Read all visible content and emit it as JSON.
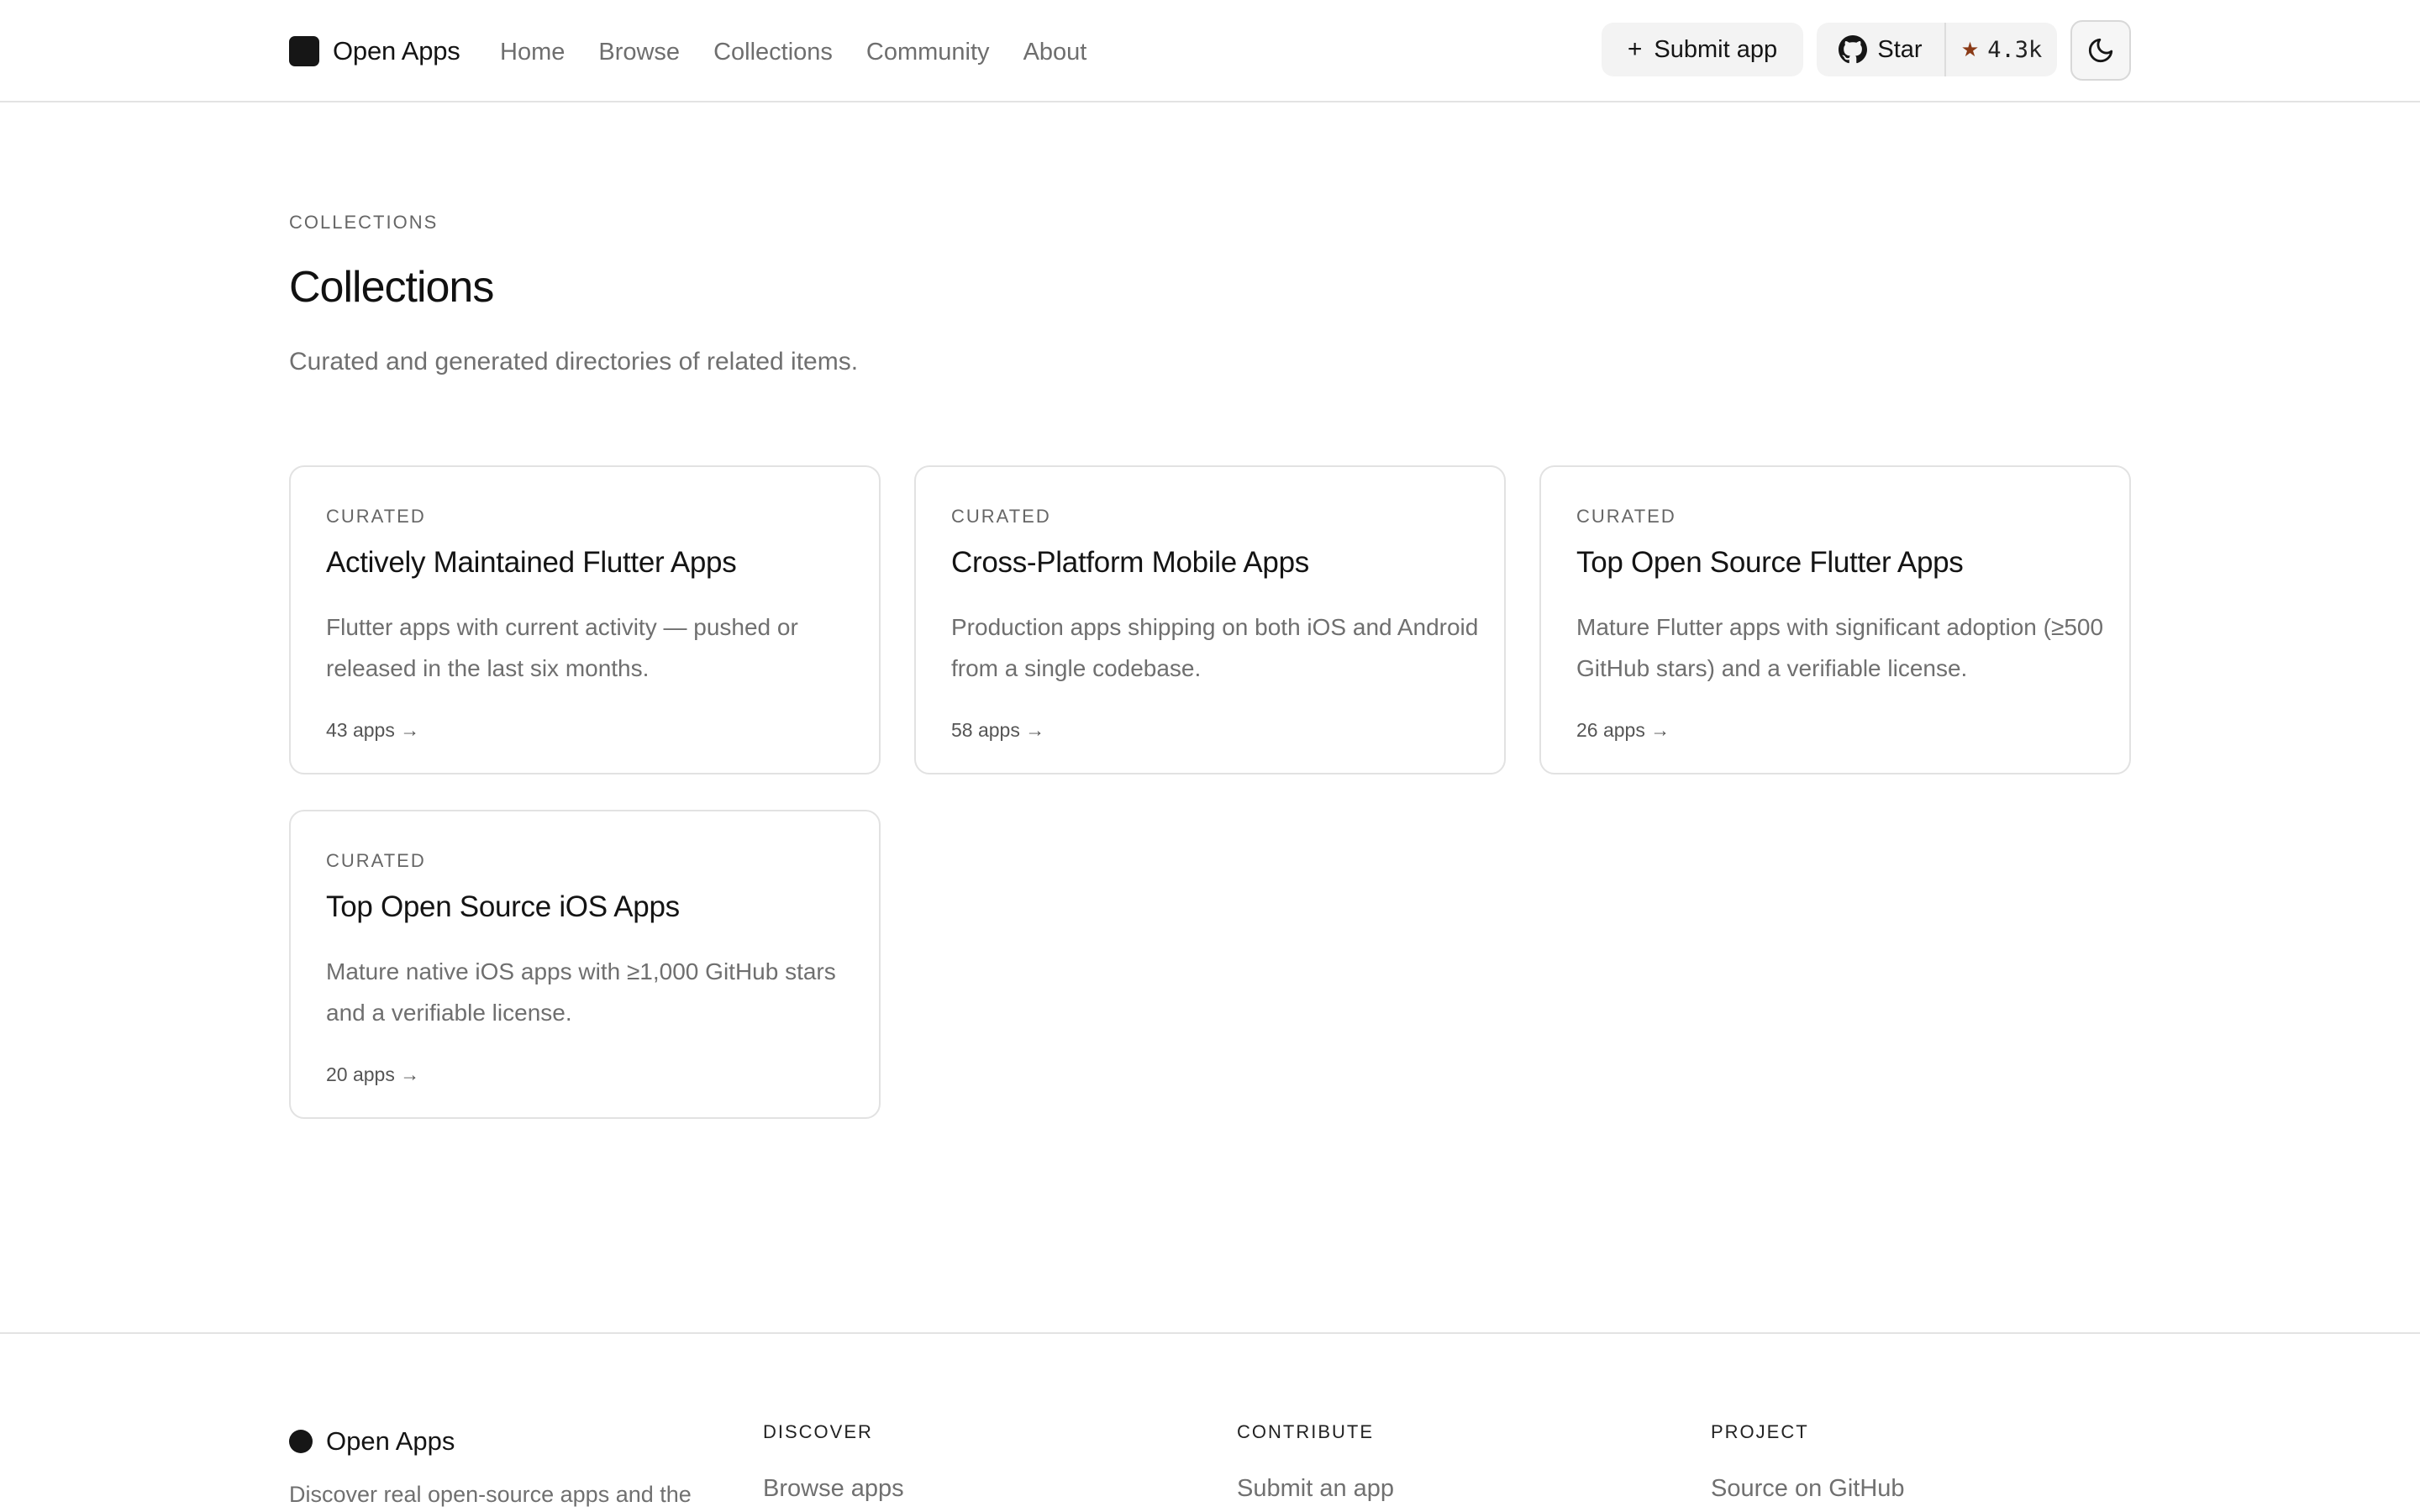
{
  "header": {
    "brand": "Open Apps",
    "nav": [
      "Home",
      "Browse",
      "Collections",
      "Community",
      "About"
    ],
    "submit_label": "Submit app",
    "star_label": "Star",
    "star_count": "4.3k"
  },
  "main": {
    "eyebrow": "COLLECTIONS",
    "title": "Collections",
    "subtitle": "Curated and generated directories of related items.",
    "collections": [
      {
        "tag": "CURATED",
        "title": "Actively Maintained Flutter Apps",
        "description": "Flutter apps with current activity — pushed or released in the last six months.",
        "count": "43 apps →"
      },
      {
        "tag": "CURATED",
        "title": "Cross-Platform Mobile Apps",
        "description": "Production apps shipping on both iOS and Android from a single codebase.",
        "count": "58 apps →"
      },
      {
        "tag": "CURATED",
        "title": "Top Open Source Flutter Apps",
        "description": "Mature Flutter apps with significant adoption (≥500 GitHub stars) and a verifiable license.",
        "count": "26 apps →"
      },
      {
        "tag": "CURATED",
        "title": "Top Open Source iOS Apps",
        "description": "Mature native iOS apps with ≥1,000 GitHub stars and a verifiable license.",
        "count": "20 apps →"
      }
    ]
  },
  "footer": {
    "brand": "Open Apps",
    "description": "Discover real open-source apps and the",
    "columns": [
      {
        "heading": "DISCOVER",
        "link": "Browse apps"
      },
      {
        "heading": "CONTRIBUTE",
        "link": "Submit an app"
      },
      {
        "heading": "PROJECT",
        "link": "Source on GitHub"
      }
    ]
  },
  "colors": {
    "accent_star": "#8a3a16",
    "text_primary": "#111111",
    "text_muted": "#707070",
    "border": "#e2e2e2"
  }
}
